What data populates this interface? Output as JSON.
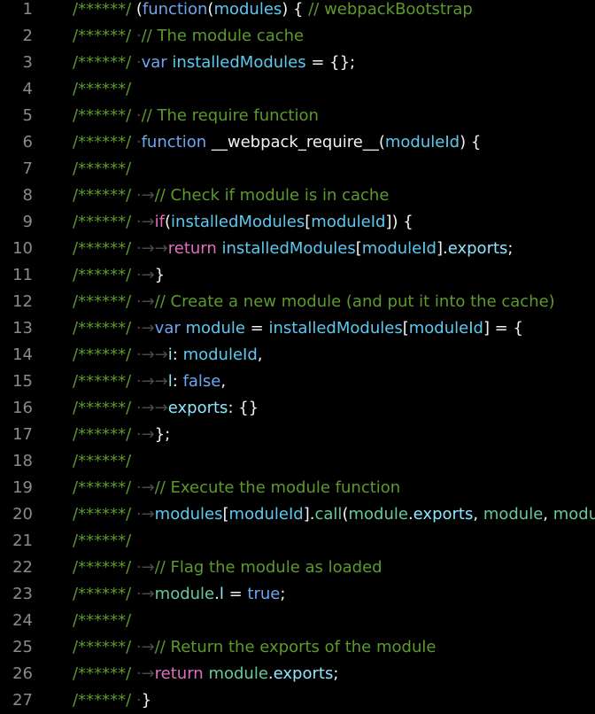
{
  "editor": {
    "colors": {
      "background": "#000000",
      "line_number": "#8a8a8a",
      "comment": "#5c9a2c",
      "keyword": "#6ea6ee",
      "control": "#e06fbf",
      "identifier": "#5ec9f0",
      "call": "#68c99c",
      "property": "#8fe5ff",
      "punctuation": "#f2f2f2",
      "invisible": "#4a4a4a"
    },
    "lines": [
      {
        "number": "1",
        "tokens": [
          [
            "comment",
            "/******/ "
          ],
          [
            "punct",
            "("
          ],
          [
            "keyword",
            "function"
          ],
          [
            "punct",
            "("
          ],
          [
            "ident",
            "modules"
          ],
          [
            "punct",
            ") { "
          ],
          [
            "comment",
            "// webpackBootstrap"
          ]
        ]
      },
      {
        "number": "2",
        "tokens": [
          [
            "comment",
            "/******/ "
          ],
          [
            "ws",
            "·"
          ],
          [
            "comment",
            "// The module cache"
          ]
        ]
      },
      {
        "number": "3",
        "tokens": [
          [
            "comment",
            "/******/ "
          ],
          [
            "ws",
            "·"
          ],
          [
            "keyword",
            "var "
          ],
          [
            "ident",
            "installedModules"
          ],
          [
            "punct",
            " = {};"
          ]
        ]
      },
      {
        "number": "4",
        "tokens": [
          [
            "comment",
            "/******/"
          ]
        ]
      },
      {
        "number": "5",
        "tokens": [
          [
            "comment",
            "/******/ "
          ],
          [
            "ws",
            "·"
          ],
          [
            "comment",
            "// The require function"
          ]
        ]
      },
      {
        "number": "6",
        "tokens": [
          [
            "comment",
            "/******/ "
          ],
          [
            "ws",
            "·"
          ],
          [
            "keyword",
            "function "
          ],
          [
            "punct",
            "__webpack_require__("
          ],
          [
            "ident",
            "moduleId"
          ],
          [
            "punct",
            ") {"
          ]
        ]
      },
      {
        "number": "7",
        "tokens": [
          [
            "comment",
            "/******/"
          ]
        ]
      },
      {
        "number": "8",
        "tokens": [
          [
            "comment",
            "/******/ "
          ],
          [
            "tab",
            "·→"
          ],
          [
            "comment",
            "// Check if module is in cache"
          ]
        ]
      },
      {
        "number": "9",
        "tokens": [
          [
            "comment",
            "/******/ "
          ],
          [
            "tab",
            "·→"
          ],
          [
            "control",
            "if"
          ],
          [
            "punct",
            "("
          ],
          [
            "ident",
            "installedModules"
          ],
          [
            "punct",
            "["
          ],
          [
            "ident",
            "moduleId"
          ],
          [
            "punct",
            "]) {"
          ]
        ]
      },
      {
        "number": "10",
        "tokens": [
          [
            "comment",
            "/******/ "
          ],
          [
            "tab",
            "·→→"
          ],
          [
            "control",
            "return "
          ],
          [
            "ident",
            "installedModules"
          ],
          [
            "punct",
            "["
          ],
          [
            "ident",
            "moduleId"
          ],
          [
            "punct",
            "]."
          ],
          [
            "prop",
            "exports"
          ],
          [
            "punct",
            ";"
          ]
        ]
      },
      {
        "number": "11",
        "tokens": [
          [
            "comment",
            "/******/ "
          ],
          [
            "tab",
            "·→"
          ],
          [
            "punct",
            "}"
          ]
        ]
      },
      {
        "number": "12",
        "tokens": [
          [
            "comment",
            "/******/ "
          ],
          [
            "tab",
            "·→"
          ],
          [
            "comment",
            "// Create a new module (and put it into the cache)"
          ]
        ]
      },
      {
        "number": "13",
        "tokens": [
          [
            "comment",
            "/******/ "
          ],
          [
            "tab",
            "·→"
          ],
          [
            "keyword",
            "var "
          ],
          [
            "ident",
            "module"
          ],
          [
            "punct",
            " = "
          ],
          [
            "ident",
            "installedModules"
          ],
          [
            "punct",
            "["
          ],
          [
            "ident",
            "moduleId"
          ],
          [
            "punct",
            "] = {"
          ]
        ]
      },
      {
        "number": "14",
        "tokens": [
          [
            "comment",
            "/******/ "
          ],
          [
            "tab",
            "·→→"
          ],
          [
            "prop",
            "i"
          ],
          [
            "punct",
            ": "
          ],
          [
            "ident",
            "moduleId"
          ],
          [
            "punct",
            ","
          ]
        ]
      },
      {
        "number": "15",
        "tokens": [
          [
            "comment",
            "/******/ "
          ],
          [
            "tab",
            "·→→"
          ],
          [
            "prop",
            "l"
          ],
          [
            "punct",
            ": "
          ],
          [
            "keyword",
            "false"
          ],
          [
            "punct",
            ","
          ]
        ]
      },
      {
        "number": "16",
        "tokens": [
          [
            "comment",
            "/******/ "
          ],
          [
            "tab",
            "·→→"
          ],
          [
            "prop",
            "exports"
          ],
          [
            "punct",
            ": {}"
          ]
        ]
      },
      {
        "number": "17",
        "tokens": [
          [
            "comment",
            "/******/ "
          ],
          [
            "tab",
            "·→"
          ],
          [
            "punct",
            "};"
          ]
        ]
      },
      {
        "number": "18",
        "tokens": [
          [
            "comment",
            "/******/"
          ]
        ]
      },
      {
        "number": "19",
        "tokens": [
          [
            "comment",
            "/******/ "
          ],
          [
            "tab",
            "·→"
          ],
          [
            "comment",
            "// Execute the module function"
          ]
        ]
      },
      {
        "number": "20",
        "tokens": [
          [
            "comment",
            "/******/ "
          ],
          [
            "tab",
            "·→"
          ],
          [
            "ident",
            "modules"
          ],
          [
            "punct",
            "["
          ],
          [
            "ident",
            "moduleId"
          ],
          [
            "punct",
            "]."
          ],
          [
            "call",
            "call"
          ],
          [
            "punct",
            "("
          ],
          [
            "call",
            "module"
          ],
          [
            "punct",
            "."
          ],
          [
            "prop",
            "exports"
          ],
          [
            "punct",
            ", "
          ],
          [
            "call",
            "module"
          ],
          [
            "punct",
            ", "
          ],
          [
            "call",
            "module"
          ]
        ]
      },
      {
        "number": "21",
        "tokens": [
          [
            "comment",
            "/******/"
          ]
        ]
      },
      {
        "number": "22",
        "tokens": [
          [
            "comment",
            "/******/ "
          ],
          [
            "tab",
            "·→"
          ],
          [
            "comment",
            "// Flag the module as loaded"
          ]
        ]
      },
      {
        "number": "23",
        "tokens": [
          [
            "comment",
            "/******/ "
          ],
          [
            "tab",
            "·→"
          ],
          [
            "call",
            "module"
          ],
          [
            "punct",
            "."
          ],
          [
            "prop",
            "l"
          ],
          [
            "punct",
            " = "
          ],
          [
            "keyword",
            "true"
          ],
          [
            "punct",
            ";"
          ]
        ]
      },
      {
        "number": "24",
        "tokens": [
          [
            "comment",
            "/******/"
          ]
        ]
      },
      {
        "number": "25",
        "tokens": [
          [
            "comment",
            "/******/ "
          ],
          [
            "tab",
            "·→"
          ],
          [
            "comment",
            "// Return the exports of the module"
          ]
        ]
      },
      {
        "number": "26",
        "tokens": [
          [
            "comment",
            "/******/ "
          ],
          [
            "tab",
            "·→"
          ],
          [
            "control",
            "return "
          ],
          [
            "call",
            "module"
          ],
          [
            "punct",
            "."
          ],
          [
            "prop",
            "exports"
          ],
          [
            "punct",
            ";"
          ]
        ]
      },
      {
        "number": "27",
        "tokens": [
          [
            "comment",
            "/******/ "
          ],
          [
            "ws",
            "·"
          ],
          [
            "punct",
            "}"
          ]
        ]
      }
    ]
  }
}
